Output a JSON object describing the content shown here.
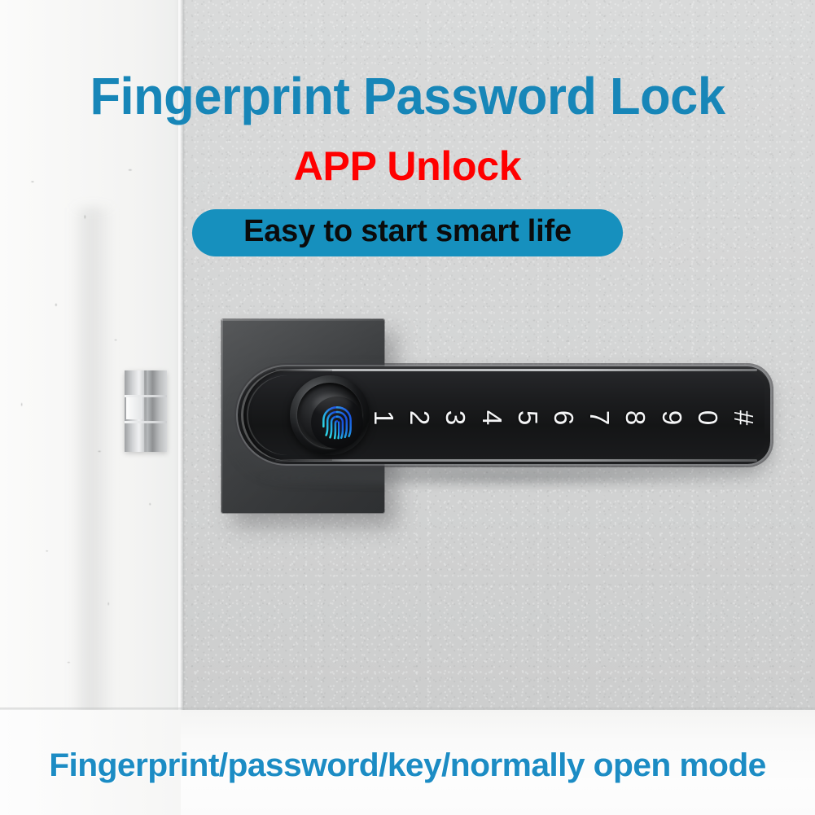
{
  "headline": {
    "text": "Fingerprint Password Lock",
    "color": "#1786B8"
  },
  "subheadline": {
    "text": "APP Unlock",
    "color": "#FF0000"
  },
  "tagline": {
    "text": "Easy to start smart life",
    "text_color": "#0B0B0B",
    "background_color": "#1690BE"
  },
  "footer": {
    "text": "Fingerprint/password/key/normally open mode",
    "color": "#1C8CC4"
  },
  "product": {
    "name": "smart-fingerprint-door-handle",
    "body_color": "#1A1B1D",
    "plate_color": "#3E4042",
    "sensor": {
      "icon": "fingerprint-icon",
      "gradient_from": "#2FD8E6",
      "gradient_to": "#1640DC"
    },
    "keypad": {
      "keys": [
        "1",
        "2",
        "3",
        "4",
        "5",
        "6",
        "7",
        "8",
        "9",
        "0",
        "#"
      ],
      "key_color": "#F4F5F6"
    },
    "latch": {
      "name": "key-cylinder",
      "color": "#B9BBBD"
    }
  },
  "background": {
    "wall_color": "#D4D5D5",
    "panel_color": "#F7F7F6",
    "floor_color": "#FBFBFB"
  }
}
